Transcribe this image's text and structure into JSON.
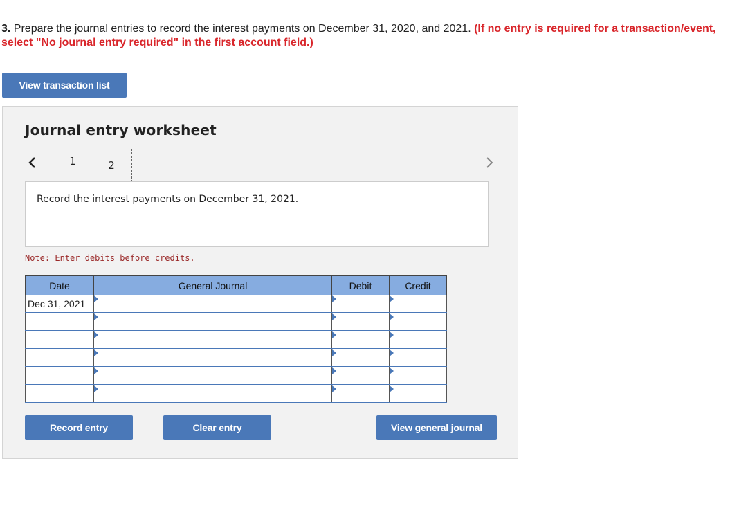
{
  "question": {
    "number": "3.",
    "text": " Prepare the journal entries to record the interest payments on December 31, 2020, and 2021. ",
    "instruction": "(If no entry is required for a transaction/event, select \"No journal entry required\" in the first account field.)"
  },
  "buttons": {
    "view_transaction_list": "View transaction list",
    "record_entry": "Record entry",
    "clear_entry": "Clear entry",
    "view_general_journal": "View general journal"
  },
  "worksheet": {
    "title": "Journal entry worksheet",
    "pages": [
      "1",
      "2"
    ],
    "current_page": "2",
    "prev_icon": "chevron-left-icon",
    "next_icon": "chevron-right-icon",
    "description": "Record the interest payments on December 31, 2021.",
    "note": "Note: Enter debits before credits."
  },
  "journal": {
    "headers": [
      "Date",
      "General Journal",
      "Debit",
      "Credit"
    ],
    "rows": [
      {
        "date": "Dec 31, 2021",
        "account": "",
        "debit": "",
        "credit": ""
      },
      {
        "date": "",
        "account": "",
        "debit": "",
        "credit": ""
      },
      {
        "date": "",
        "account": "",
        "debit": "",
        "credit": ""
      },
      {
        "date": "",
        "account": "",
        "debit": "",
        "credit": ""
      },
      {
        "date": "",
        "account": "",
        "debit": "",
        "credit": ""
      },
      {
        "date": "",
        "account": "",
        "debit": "",
        "credit": ""
      }
    ]
  },
  "colors": {
    "accent": "#4a78b8",
    "header_bg": "#86ace0",
    "instruction_red": "#d9262b",
    "note_red": "#9b2a2a",
    "panel_bg": "#f2f2f2"
  }
}
